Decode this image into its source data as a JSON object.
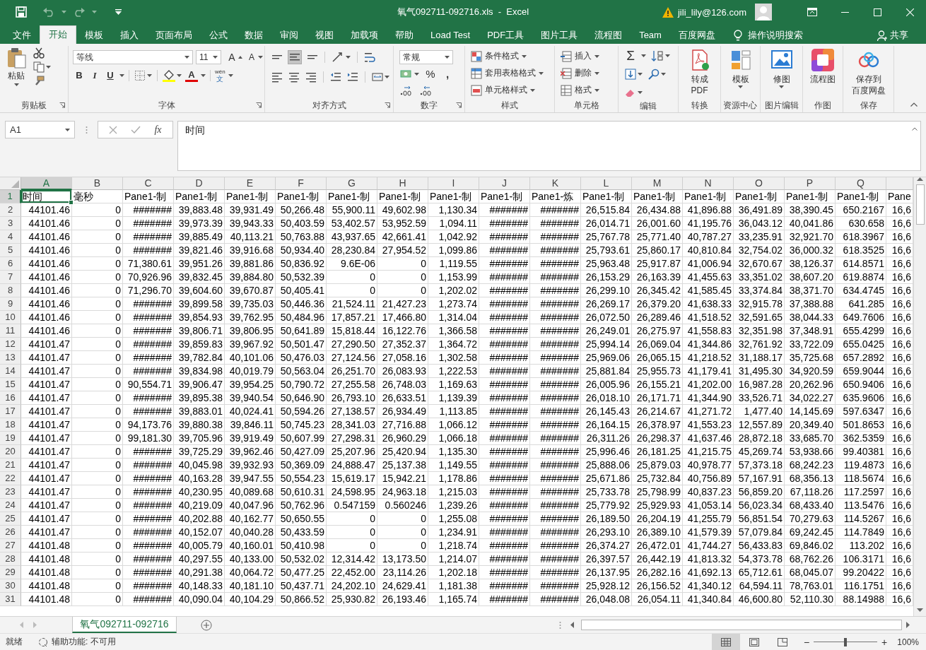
{
  "window": {
    "title": "氧气092711-092716.xls  -  Excel",
    "user": "jili_lily@126.com"
  },
  "menu_tabs": [
    {
      "label": "文件",
      "selected": false
    },
    {
      "label": "开始",
      "selected": true
    },
    {
      "label": "模板",
      "selected": false
    },
    {
      "label": "插入",
      "selected": false
    },
    {
      "label": "页面布局",
      "selected": false
    },
    {
      "label": "公式",
      "selected": false
    },
    {
      "label": "数据",
      "selected": false
    },
    {
      "label": "审阅",
      "selected": false
    },
    {
      "label": "视图",
      "selected": false
    },
    {
      "label": "加载项",
      "selected": false
    },
    {
      "label": "帮助",
      "selected": false
    },
    {
      "label": "Load Test",
      "selected": false
    },
    {
      "label": "PDF工具",
      "selected": false
    },
    {
      "label": "图片工具",
      "selected": false
    },
    {
      "label": "流程图",
      "selected": false
    },
    {
      "label": "Team",
      "selected": false
    },
    {
      "label": "百度网盘",
      "selected": false
    }
  ],
  "tell_me": "操作说明搜索",
  "share": "共享",
  "ribbon": {
    "groups": [
      {
        "kind": "clipboard",
        "label": "剪贴板",
        "launcher": true,
        "paste": "粘贴"
      },
      {
        "kind": "font",
        "label": "字体",
        "launcher": true,
        "font": "等线",
        "size": "11",
        "grow": "A",
        "shrink": "A",
        "bold": "B",
        "italic": "I",
        "underline": "U",
        "font_color": "A",
        "phonetic_top": "wén",
        "phonetic_bottom": "文"
      },
      {
        "kind": "alignment",
        "label": "对齐方式",
        "launcher": true
      },
      {
        "kind": "number",
        "label": "数字",
        "launcher": true,
        "format": "常规",
        "percent": "%",
        "comma": ","
      },
      {
        "kind": "list",
        "label": "样式",
        "launcher": false,
        "items": [
          "条件格式",
          "套用表格格式",
          "单元格样式"
        ]
      },
      {
        "kind": "list",
        "label": "单元格",
        "launcher": false,
        "items": [
          "插入",
          "删除",
          "格式"
        ]
      },
      {
        "kind": "editing",
        "label": "编辑",
        "launcher": false,
        "sum": "Σ"
      },
      {
        "kind": "large",
        "label": "转换",
        "launcher": false,
        "lines": [
          "转成",
          "PDF"
        ],
        "caret": false
      },
      {
        "kind": "large",
        "label": "资源中心",
        "launcher": false,
        "lines": [
          "模板"
        ],
        "caret": true
      },
      {
        "kind": "large",
        "label": "图片编辑",
        "launcher": false,
        "lines": [
          "修图"
        ],
        "caret": true
      },
      {
        "kind": "large",
        "label": "作图",
        "launcher": false,
        "lines": [
          "流程图"
        ],
        "caret": false
      },
      {
        "kind": "large",
        "label": "保存",
        "launcher": false,
        "lines": [
          "保存到",
          "百度网盘"
        ],
        "caret": false
      }
    ]
  },
  "formula_bar": {
    "name_box": "A1",
    "function_label": "fx",
    "content": "时间"
  },
  "sheet": {
    "columns": [
      {
        "label": "A",
        "selected": true
      },
      {
        "label": "B",
        "selected": false
      },
      {
        "label": "C",
        "selected": false
      },
      {
        "label": "D",
        "selected": false
      },
      {
        "label": "E",
        "selected": false
      },
      {
        "label": "F",
        "selected": false
      },
      {
        "label": "G",
        "selected": false
      },
      {
        "label": "H",
        "selected": false
      },
      {
        "label": "I",
        "selected": false
      },
      {
        "label": "J",
        "selected": false
      },
      {
        "label": "K",
        "selected": false
      },
      {
        "label": "L",
        "selected": false
      },
      {
        "label": "M",
        "selected": false
      },
      {
        "label": "N",
        "selected": false
      },
      {
        "label": "O",
        "selected": false
      },
      {
        "label": "P",
        "selected": false
      },
      {
        "label": "Q",
        "selected": false
      },
      {
        "selected": false
      }
    ],
    "rows": [
      {
        "label": "1",
        "selected": true,
        "kind": "labels",
        "cells": [
          "时间",
          "毫秒",
          "Pane1-制",
          "Pane1-制",
          "Pane1-制",
          "Pane1-制",
          "Pane1-制",
          "Pane1-制",
          "Pane1-制",
          "Pane1-制",
          "Pane1-炼",
          "Pane1-制",
          "Pane1-制",
          "Pane1-制",
          "Pane1-制",
          "Pane1-制",
          "Pane1-制",
          "Pane"
        ]
      },
      {
        "label": "2",
        "selected": false,
        "kind": "values",
        "cells": [
          "44101.46",
          "0",
          "#######",
          "39,883.48",
          "39,931.49",
          "50,266.48",
          "55,900.11",
          "49,602.98",
          "1,130.34",
          "#######",
          "#######",
          "26,515.84",
          "26,434.88",
          "41,896.88",
          "36,491.89",
          "38,390.45",
          "650.2167",
          "16,6"
        ]
      },
      {
        "label": "3",
        "selected": false,
        "kind": "values",
        "cells": [
          "44101.46",
          "0",
          "#######",
          "39,973.39",
          "39,943.33",
          "50,403.59",
          "53,402.57",
          "53,952.59",
          "1,094.11",
          "#######",
          "#######",
          "26,014.71",
          "26,001.60",
          "41,195.76",
          "36,043.12",
          "40,041.86",
          "630.658",
          "16,6"
        ]
      },
      {
        "label": "4",
        "selected": false,
        "kind": "values",
        "cells": [
          "44101.46",
          "0",
          "#######",
          "39,885.49",
          "40,113.21",
          "50,763.88",
          "43,937.65",
          "42,661.41",
          "1,042.92",
          "#######",
          "#######",
          "25,767.78",
          "25,771.40",
          "40,787.27",
          "33,235.91",
          "32,921.70",
          "618.3967",
          "16,6"
        ]
      },
      {
        "label": "5",
        "selected": false,
        "kind": "values",
        "cells": [
          "44101.46",
          "0",
          "#######",
          "39,821.46",
          "39,916.68",
          "50,934.40",
          "28,230.84",
          "27,954.52",
          "1,099.86",
          "#######",
          "#######",
          "25,793.61",
          "25,860.17",
          "40,810.84",
          "32,754.02",
          "36,000.32",
          "618.3525",
          "16,6"
        ]
      },
      {
        "label": "6",
        "selected": false,
        "kind": "values",
        "cells": [
          "44101.46",
          "0",
          "71,380.61",
          "39,951.26",
          "39,881.86",
          "50,836.92",
          "9.6E-06",
          "0",
          "1,119.55",
          "#######",
          "#######",
          "25,963.48",
          "25,917.87",
          "41,006.94",
          "32,670.67",
          "38,126.37",
          "614.8571",
          "16,6"
        ]
      },
      {
        "label": "7",
        "selected": false,
        "kind": "values",
        "cells": [
          "44101.46",
          "0",
          "70,926.96",
          "39,832.45",
          "39,884.80",
          "50,532.39",
          "0",
          "0",
          "1,153.99",
          "#######",
          "#######",
          "26,153.29",
          "26,163.39",
          "41,455.63",
          "33,351.02",
          "38,607.20",
          "619.8874",
          "16,6"
        ]
      },
      {
        "label": "8",
        "selected": false,
        "kind": "values",
        "cells": [
          "44101.46",
          "0",
          "71,296.70",
          "39,604.60",
          "39,670.87",
          "50,405.41",
          "0",
          "0",
          "1,202.02",
          "#######",
          "#######",
          "26,299.10",
          "26,345.42",
          "41,585.45",
          "33,374.84",
          "38,371.70",
          "634.4745",
          "16,6"
        ]
      },
      {
        "label": "9",
        "selected": false,
        "kind": "values",
        "cells": [
          "44101.46",
          "0",
          "#######",
          "39,899.58",
          "39,735.03",
          "50,446.36",
          "21,524.11",
          "21,427.23",
          "1,273.74",
          "#######",
          "#######",
          "26,269.17",
          "26,379.20",
          "41,638.33",
          "32,915.78",
          "37,388.88",
          "641.285",
          "16,6"
        ]
      },
      {
        "label": "10",
        "selected": false,
        "kind": "values",
        "cells": [
          "44101.46",
          "0",
          "#######",
          "39,854.93",
          "39,762.95",
          "50,484.96",
          "17,857.21",
          "17,466.80",
          "1,314.04",
          "#######",
          "#######",
          "26,072.50",
          "26,289.46",
          "41,518.52",
          "32,591.65",
          "38,044.33",
          "649.7606",
          "16,6"
        ]
      },
      {
        "label": "11",
        "selected": false,
        "kind": "values",
        "cells": [
          "44101.46",
          "0",
          "#######",
          "39,806.71",
          "39,806.95",
          "50,641.89",
          "15,818.44",
          "16,122.76",
          "1,366.58",
          "#######",
          "#######",
          "26,249.01",
          "26,275.97",
          "41,558.83",
          "32,351.98",
          "37,348.91",
          "655.4299",
          "16,6"
        ]
      },
      {
        "label": "12",
        "selected": false,
        "kind": "values",
        "cells": [
          "44101.47",
          "0",
          "#######",
          "39,859.83",
          "39,967.92",
          "50,501.47",
          "27,290.50",
          "27,352.37",
          "1,364.72",
          "#######",
          "#######",
          "25,994.14",
          "26,069.04",
          "41,344.86",
          "32,761.92",
          "33,722.09",
          "655.0425",
          "16,6"
        ]
      },
      {
        "label": "13",
        "selected": false,
        "kind": "values",
        "cells": [
          "44101.47",
          "0",
          "#######",
          "39,782.84",
          "40,101.06",
          "50,476.03",
          "27,124.56",
          "27,058.16",
          "1,302.58",
          "#######",
          "#######",
          "25,969.06",
          "26,065.15",
          "41,218.52",
          "31,188.17",
          "35,725.68",
          "657.2892",
          "16,6"
        ]
      },
      {
        "label": "14",
        "selected": false,
        "kind": "values",
        "cells": [
          "44101.47",
          "0",
          "#######",
          "39,834.98",
          "40,019.79",
          "50,563.04",
          "26,251.70",
          "26,083.93",
          "1,222.53",
          "#######",
          "#######",
          "25,881.84",
          "25,955.73",
          "41,179.41",
          "31,495.30",
          "34,920.59",
          "659.9044",
          "16,6"
        ]
      },
      {
        "label": "15",
        "selected": false,
        "kind": "values",
        "cells": [
          "44101.47",
          "0",
          "90,554.71",
          "39,906.47",
          "39,954.25",
          "50,790.72",
          "27,255.58",
          "26,748.03",
          "1,169.63",
          "#######",
          "#######",
          "26,005.96",
          "26,155.21",
          "41,202.00",
          "16,987.28",
          "20,262.96",
          "650.9406",
          "16,6"
        ]
      },
      {
        "label": "16",
        "selected": false,
        "kind": "values",
        "cells": [
          "44101.47",
          "0",
          "#######",
          "39,895.38",
          "39,940.54",
          "50,646.90",
          "26,793.10",
          "26,633.51",
          "1,139.39",
          "#######",
          "#######",
          "26,018.10",
          "26,171.71",
          "41,344.90",
          "33,526.71",
          "34,022.27",
          "635.9606",
          "16,6"
        ]
      },
      {
        "label": "17",
        "selected": false,
        "kind": "values",
        "cells": [
          "44101.47",
          "0",
          "#######",
          "39,883.01",
          "40,024.41",
          "50,594.26",
          "27,138.57",
          "26,934.49",
          "1,113.85",
          "#######",
          "#######",
          "26,145.43",
          "26,214.67",
          "41,271.72",
          "1,477.40",
          "14,145.69",
          "597.6347",
          "16,6"
        ]
      },
      {
        "label": "18",
        "selected": false,
        "kind": "values",
        "cells": [
          "44101.47",
          "0",
          "94,173.76",
          "39,880.38",
          "39,846.11",
          "50,745.23",
          "28,341.03",
          "27,716.88",
          "1,066.12",
          "#######",
          "#######",
          "26,164.15",
          "26,378.97",
          "41,553.23",
          "12,557.89",
          "20,349.40",
          "501.8653",
          "16,6"
        ]
      },
      {
        "label": "19",
        "selected": false,
        "kind": "values",
        "cells": [
          "44101.47",
          "0",
          "99,181.30",
          "39,705.96",
          "39,919.49",
          "50,607.99",
          "27,298.31",
          "26,960.29",
          "1,066.18",
          "#######",
          "#######",
          "26,311.26",
          "26,298.37",
          "41,637.46",
          "28,872.18",
          "33,685.70",
          "362.5359",
          "16,6"
        ]
      },
      {
        "label": "20",
        "selected": false,
        "kind": "values",
        "cells": [
          "44101.47",
          "0",
          "#######",
          "39,725.29",
          "39,962.46",
          "50,427.09",
          "25,207.96",
          "25,420.94",
          "1,135.30",
          "#######",
          "#######",
          "25,996.46",
          "26,181.25",
          "41,215.75",
          "45,269.74",
          "53,938.66",
          "99.40381",
          "16,6"
        ]
      },
      {
        "label": "21",
        "selected": false,
        "kind": "values",
        "cells": [
          "44101.47",
          "0",
          "#######",
          "40,045.98",
          "39,932.93",
          "50,369.09",
          "24,888.47",
          "25,137.38",
          "1,149.55",
          "#######",
          "#######",
          "25,888.06",
          "25,879.03",
          "40,978.77",
          "57,373.18",
          "68,242.23",
          "119.4873",
          "16,6"
        ]
      },
      {
        "label": "22",
        "selected": false,
        "kind": "values",
        "cells": [
          "44101.47",
          "0",
          "#######",
          "40,163.28",
          "39,947.55",
          "50,554.23",
          "15,619.17",
          "15,942.21",
          "1,178.86",
          "#######",
          "#######",
          "25,671.86",
          "25,732.84",
          "40,756.89",
          "57,167.91",
          "68,356.13",
          "118.5674",
          "16,6"
        ]
      },
      {
        "label": "23",
        "selected": false,
        "kind": "values",
        "cells": [
          "44101.47",
          "0",
          "#######",
          "40,230.95",
          "40,089.68",
          "50,610.31",
          "24,598.95",
          "24,963.18",
          "1,215.03",
          "#######",
          "#######",
          "25,733.78",
          "25,798.99",
          "40,837.23",
          "56,859.20",
          "67,118.26",
          "117.2597",
          "16,6"
        ]
      },
      {
        "label": "24",
        "selected": false,
        "kind": "values",
        "cells": [
          "44101.47",
          "0",
          "#######",
          "40,219.09",
          "40,047.96",
          "50,762.96",
          "0.547159",
          "0.560246",
          "1,239.26",
          "#######",
          "#######",
          "25,779.92",
          "25,929.93",
          "41,053.14",
          "56,023.34",
          "68,433.40",
          "113.5476",
          "16,6"
        ]
      },
      {
        "label": "25",
        "selected": false,
        "kind": "values",
        "cells": [
          "44101.47",
          "0",
          "#######",
          "40,202.88",
          "40,162.77",
          "50,650.55",
          "0",
          "0",
          "1,255.08",
          "#######",
          "#######",
          "26,189.50",
          "26,204.19",
          "41,255.79",
          "56,851.54",
          "70,279.63",
          "114.5267",
          "16,6"
        ]
      },
      {
        "label": "26",
        "selected": false,
        "kind": "values",
        "cells": [
          "44101.47",
          "0",
          "#######",
          "40,152.07",
          "40,040.28",
          "50,433.59",
          "0",
          "0",
          "1,234.91",
          "#######",
          "#######",
          "26,293.10",
          "26,389.10",
          "41,579.39",
          "57,079.84",
          "69,242.45",
          "114.7849",
          "16,6"
        ]
      },
      {
        "label": "27",
        "selected": false,
        "kind": "values",
        "cells": [
          "44101.48",
          "0",
          "#######",
          "40,005.79",
          "40,160.01",
          "50,410.98",
          "0",
          "0",
          "1,218.74",
          "#######",
          "#######",
          "26,374.27",
          "26,472.01",
          "41,744.27",
          "56,433.83",
          "69,846.02",
          "113.202",
          "16,6"
        ]
      },
      {
        "label": "28",
        "selected": false,
        "kind": "values",
        "cells": [
          "44101.48",
          "0",
          "#######",
          "40,297.55",
          "40,133.00",
          "50,532.02",
          "12,314.42",
          "13,173.50",
          "1,214.07",
          "#######",
          "#######",
          "26,397.57",
          "26,442.19",
          "41,813.32",
          "54,373.78",
          "68,762.26",
          "106.3171",
          "16,6"
        ]
      },
      {
        "label": "29",
        "selected": false,
        "kind": "values",
        "cells": [
          "44101.48",
          "0",
          "#######",
          "40,291.38",
          "40,064.72",
          "50,477.25",
          "22,452.00",
          "23,114.26",
          "1,202.18",
          "#######",
          "#######",
          "26,137.95",
          "26,282.16",
          "41,692.13",
          "65,712.61",
          "68,045.07",
          "99.20422",
          "16,6"
        ]
      },
      {
        "label": "30",
        "selected": false,
        "kind": "values",
        "cells": [
          "44101.48",
          "0",
          "#######",
          "40,148.33",
          "40,181.10",
          "50,437.71",
          "24,202.10",
          "24,629.41",
          "1,181.38",
          "#######",
          "#######",
          "25,928.12",
          "26,156.52",
          "41,340.12",
          "64,594.11",
          "78,763.01",
          "116.1751",
          "16,6"
        ]
      },
      {
        "label": "31",
        "selected": false,
        "kind": "values",
        "cells": [
          "44101.48",
          "0",
          "#######",
          "40,090.04",
          "40,104.29",
          "50,866.52",
          "25,930.82",
          "26,193.46",
          "1,165.74",
          "#######",
          "#######",
          "26,048.08",
          "26,054.11",
          "41,340.84",
          "46,600.80",
          "52,110.30",
          "88.14988",
          "16,6"
        ]
      }
    ]
  },
  "sheet_tabs": [
    {
      "label": "氧气092711-092716",
      "selected": true
    }
  ],
  "status_bar": {
    "status": "就绪",
    "accessibility": "辅助功能: 不可用",
    "views": [
      {
        "selected": true
      },
      {
        "selected": false
      },
      {
        "selected": false
      }
    ],
    "zoom": {
      "minus": "−",
      "plus": "+",
      "level": 0.5,
      "reading": "100%"
    }
  }
}
